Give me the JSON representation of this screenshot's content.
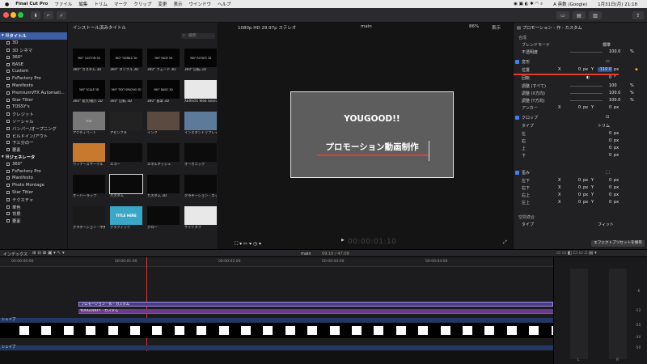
{
  "menubar": {
    "apple": "",
    "app_name": "Final Cut Pro",
    "items": [
      "ファイル",
      "編集",
      "トリム",
      "マーク",
      "クリップ",
      "変更",
      "表示",
      "ウインドウ",
      "ヘルプ"
    ],
    "input_source": "A 英数 (Google)",
    "datetime": "1月31日(月) 21:18"
  },
  "browser": {
    "title": "インストール済みタイトル",
    "search_placeholder": "検索",
    "thumbs": [
      {
        "label": "360° カスタム 3D",
        "art": "360° CUSTOM 3D"
      },
      {
        "label": "360° タンブル 3D",
        "art": "360° TUMBLE 3D"
      },
      {
        "label": "360° フェード 3D",
        "art": "360° FADE 3D"
      },
      {
        "label": "360° 回転 3D",
        "art": "360° ROTATE 3D"
      },
      {
        "label": "360° 拡大/縮小 3D",
        "art": "360° SCALE 3D"
      },
      {
        "label": "360° 回転 3D",
        "art": "360° TEXT SPACING 3D"
      },
      {
        "label": "360° 基本 3D",
        "art": "360° BASIC 3D"
      },
      {
        "label": "XEffects Web Search Page",
        "art": ""
      },
      {
        "label": "アクティベート",
        "art": "TEXT"
      },
      {
        "label": "アセンブラ",
        "art": ""
      },
      {
        "label": "インク",
        "art": ""
      },
      {
        "label": "インスタントリプレイ",
        "art": ""
      },
      {
        "label": "ウィナーズサークル",
        "art": ""
      },
      {
        "label": "エコー",
        "art": ""
      },
      {
        "label": "エネルギッシュ",
        "art": ""
      },
      {
        "label": "オーガニック",
        "art": ""
      },
      {
        "label": "オーバーラップ",
        "art": ""
      },
      {
        "label": "カスタム",
        "art": ""
      },
      {
        "label": "カスタム 3D",
        "art": ""
      },
      {
        "label": "グラデーション - エッジ",
        "art": ""
      },
      {
        "label": "グラデーション - 中央",
        "art": ""
      },
      {
        "label": "グラフィック",
        "art": "TITLE HERE"
      },
      {
        "label": "グロー",
        "art": ""
      },
      {
        "label": "サイドタブ",
        "art": ""
      }
    ]
  },
  "library": {
    "items": [
      {
        "label": "タイトル",
        "type": "cat",
        "selected": true
      },
      {
        "label": "3D"
      },
      {
        "label": "3D シネマ"
      },
      {
        "label": "360°"
      },
      {
        "label": "BASE"
      },
      {
        "label": "Custom"
      },
      {
        "label": "FxFactory Pro"
      },
      {
        "label": "Manifesto"
      },
      {
        "label": "PremiumVFX Automati..."
      },
      {
        "label": "Star Titler"
      },
      {
        "label": "TOSSY's"
      },
      {
        "label": "クレジット"
      },
      {
        "label": "ソーシャル"
      },
      {
        "label": "バンパー/オープニング"
      },
      {
        "label": "ビルドイン/アウト"
      },
      {
        "label": "下三分の一"
      },
      {
        "label": "要素"
      },
      {
        "label": "ジェネレータ",
        "type": "cat"
      },
      {
        "label": "360°"
      },
      {
        "label": "FxFactory Pro"
      },
      {
        "label": "Manifesto"
      },
      {
        "label": "Photo Montage"
      },
      {
        "label": "Star Titler"
      },
      {
        "label": "テクスチャ"
      },
      {
        "label": "単色"
      },
      {
        "label": "背景"
      },
      {
        "label": "要素"
      }
    ]
  },
  "viewer": {
    "format": "1080p HD 29.97p ステレオ",
    "project": "main",
    "zoom": "86%",
    "display_menu": "表示",
    "title_text": "YOUGOOD!!",
    "subtitle_text": "プロモーション動画制作",
    "timecode": "00:00:01:10"
  },
  "inspector": {
    "title": "プロモーション - 作 - カスタム",
    "sections": {
      "composite": "合成",
      "blend_mode_label": "ブレンドモード",
      "blend_mode_value": "標準",
      "opacity_label": "不透明度",
      "opacity_value": "100.0",
      "transform": "変形",
      "position_label": "位置",
      "position_x": "0",
      "position_y": "-110.0",
      "rotation_label": "回転",
      "rotation_value": "0",
      "scale_all_label": "調整 (すべて)",
      "scale_all_value": "100",
      "scale_x_label": "調整 (X方向)",
      "scale_x_value": "100.0",
      "scale_y_label": "調整 (Y方向)",
      "scale_y_value": "100.0",
      "anchor_label": "アンカー",
      "anchor_x": "0",
      "anchor_y": "0",
      "crop": "クロップ",
      "crop_type_label": "タイプ",
      "crop_type_value": "トリム",
      "left": "左",
      "right": "右",
      "top": "上",
      "bottom": "下",
      "crop_zero": "0",
      "distort": "歪み",
      "bottom_left": "左下",
      "bottom_right": "右下",
      "top_right": "右上",
      "top_left": "左上",
      "spatial": "空間適合",
      "spatial_type_label": "タイプ",
      "spatial_type_value": "フィット",
      "save_preset": "エフェクトプリセットを保存",
      "unit_px": "px",
      "unit_pct": "%",
      "unit_deg": "°",
      "x": "X",
      "y": "Y"
    }
  },
  "timeline": {
    "index_label": "インデックス",
    "project": "main",
    "position": "09:10 / 47:09",
    "ruler": [
      "00:00:00:00",
      "00:00:01:00",
      "00:00:02:00",
      "00:00:03:00",
      "00:00:04:00"
    ],
    "clip_1": "プロモーション - 作 - カスタム",
    "clip_2": "YOUGOOD!! - カスタム",
    "shape_1": "シェイプ",
    "shape_2": "シェイプ",
    "meter_scale": [
      "-6",
      "-12",
      "-20",
      "-30",
      "-50"
    ],
    "meter_l": "L",
    "meter_r": "R"
  }
}
